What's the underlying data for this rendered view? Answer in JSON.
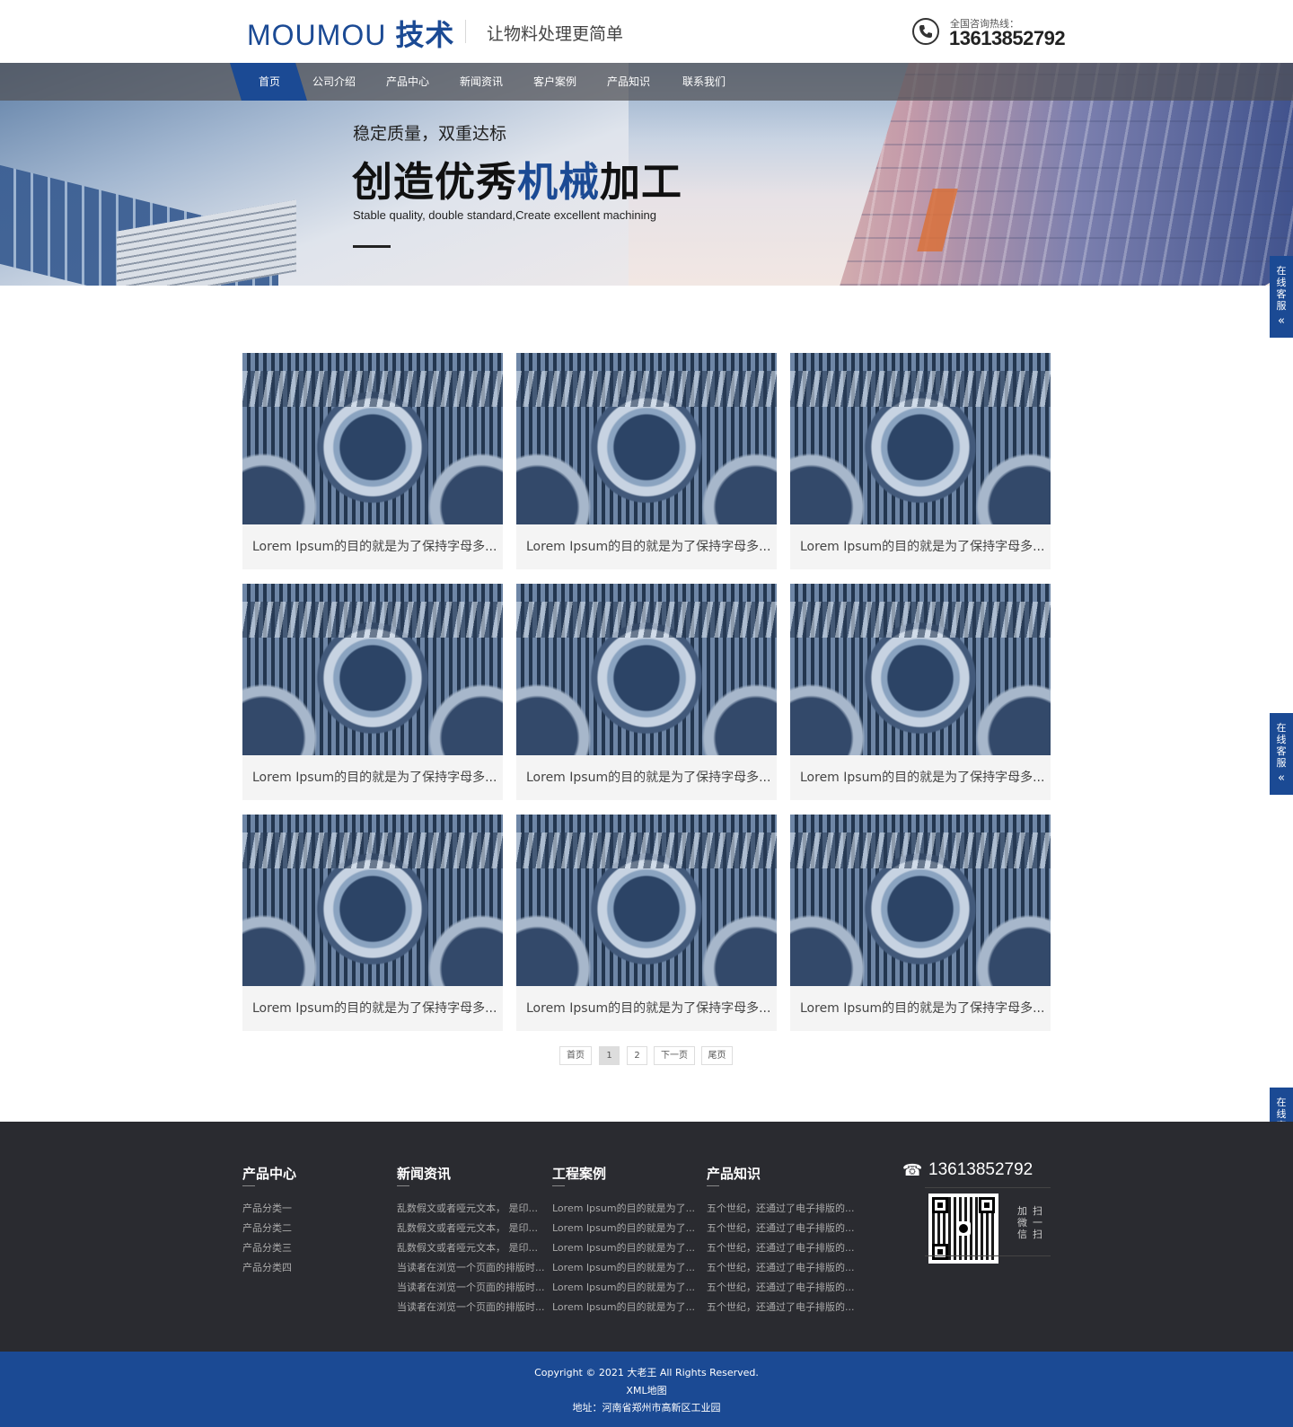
{
  "header": {
    "logo_main": "MOUMOU",
    "logo_cn": "技术",
    "slogan": "让物料处理更简单",
    "hotline_label": "全国咨询热线：",
    "hotline_number": "13613852792"
  },
  "nav": {
    "items": [
      "首页",
      "公司介绍",
      "产品中心",
      "新闻资讯",
      "客户案例",
      "产品知识",
      "联系我们"
    ],
    "active_index": 0
  },
  "hero": {
    "subtitle": "稳定质量，双重达标",
    "title_part1": "创造优秀",
    "title_highlight": "机械",
    "title_part2": "加工",
    "english": "Stable quality, double standard,Create excellent machining"
  },
  "side_service": {
    "chars": [
      "在",
      "线",
      "客",
      "服"
    ],
    "chevron": "«"
  },
  "products": {
    "caption": "Lorem Ipsum的目的就是为了保持字母多...",
    "count": 9
  },
  "pagination": [
    "首页",
    "1",
    "2",
    "下一页",
    "尾页"
  ],
  "footer": {
    "columns": [
      {
        "title": "产品中心",
        "links": [
          "产品分类一",
          "产品分类二",
          "产品分类三",
          "产品分类四"
        ]
      },
      {
        "title": "新闻资讯",
        "links": [
          "乱数假文或者哑元文本， 是印...",
          "乱数假文或者哑元文本， 是印...",
          "乱数假文或者哑元文本， 是印...",
          "当读者在浏览一个页面的排版时...",
          "当读者在浏览一个页面的排版时...",
          "当读者在浏览一个页面的排版时..."
        ]
      },
      {
        "title": "工程案例",
        "links": [
          "Lorem Ipsum的目的就是为了...",
          "Lorem Ipsum的目的就是为了...",
          "Lorem Ipsum的目的就是为了...",
          "Lorem Ipsum的目的就是为了...",
          "Lorem Ipsum的目的就是为了...",
          "Lorem Ipsum的目的就是为了..."
        ]
      },
      {
        "title": "产品知识",
        "links": [
          "五个世纪，还通过了电子排版的...",
          "五个世纪，还通过了电子排版的...",
          "五个世纪，还通过了电子排版的...",
          "五个世纪，还通过了电子排版的...",
          "五个世纪，还通过了电子排版的...",
          "五个世纪，还通过了电子排版的..."
        ]
      }
    ],
    "phone": "13613852792",
    "qr_scan_col1": "扫一扫",
    "qr_scan_col2": "加微信",
    "copyright": "Copyright © 2021 大老王 All Rights Reserved.",
    "sitemap": "XML地图",
    "address": "地址：河南省郑州市高新区工业园"
  },
  "colors": {
    "brand_blue": "#1b4a94",
    "footer_dark": "#2a2b30"
  }
}
